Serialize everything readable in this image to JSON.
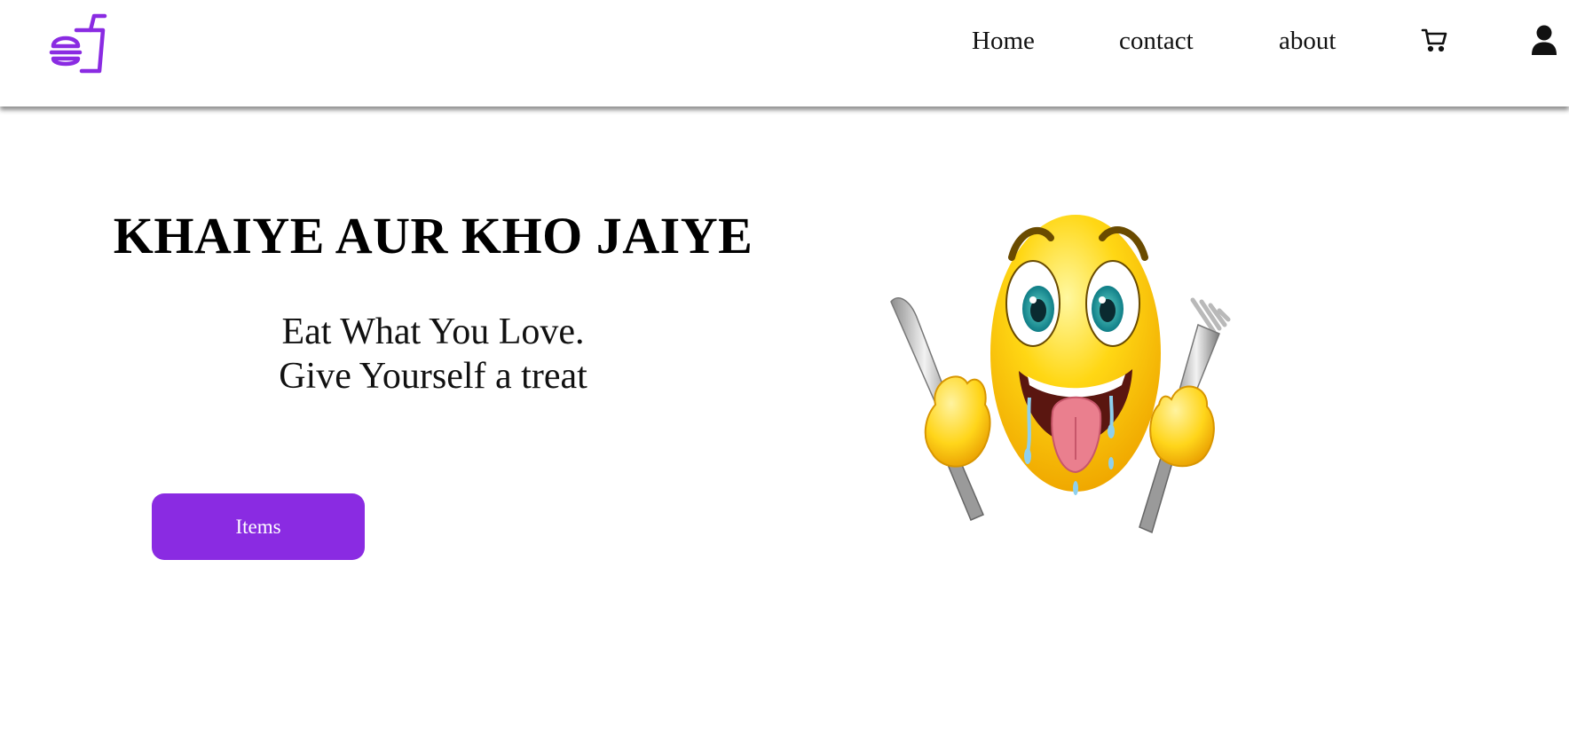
{
  "nav": {
    "logo_icon": "burger-drink-icon",
    "links": [
      "Home",
      "contact",
      "about"
    ],
    "cart_icon": "cart-icon",
    "user_icon": "user-icon"
  },
  "hero": {
    "title": "KHAIYE AUR KHO JAIYE",
    "line1": "Eat What You Love.",
    "line2": "Give Yourself a treat",
    "button_label": "Items",
    "image_icon": "hungry-emoji-with-knife-and-fork"
  },
  "colors": {
    "accent": "#8a2be2",
    "text": "#000000",
    "background": "#ffffff"
  }
}
